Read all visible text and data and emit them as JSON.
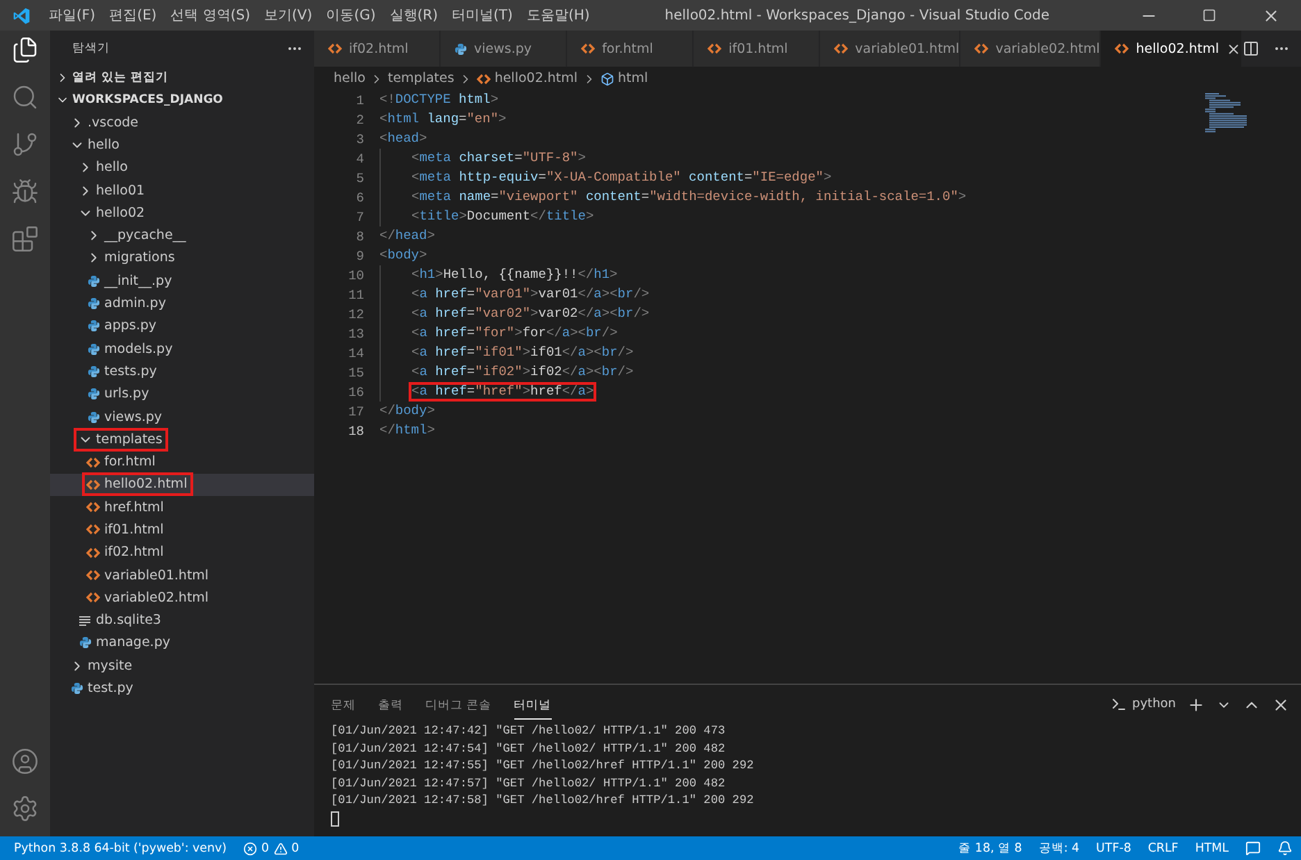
{
  "window": {
    "title": "hello02.html - Workspaces_Django - Visual Studio Code"
  },
  "menu": [
    "파일(F)",
    "편집(E)",
    "선택 영역(S)",
    "보기(V)",
    "이동(G)",
    "실행(R)",
    "터미널(T)",
    "도움말(H)"
  ],
  "sidebar": {
    "title": "탐색기",
    "sections": [
      {
        "label": "열려 있는 편집기",
        "expanded": false
      },
      {
        "label": "WORKSPACES_DJANGO",
        "expanded": true
      }
    ],
    "tree": [
      {
        "label": ".vscode",
        "kind": "folder",
        "expanded": false,
        "selected": false,
        "highlighted": false
      },
      {
        "label": "hello",
        "kind": "folder",
        "expanded": true,
        "selected": false,
        "highlighted": false,
        "children": [
          {
            "label": "hello",
            "kind": "folder",
            "expanded": false,
            "selected": false,
            "highlighted": false
          },
          {
            "label": "hello01",
            "kind": "folder",
            "expanded": false,
            "selected": false,
            "highlighted": false
          },
          {
            "label": "hello02",
            "kind": "folder",
            "expanded": true,
            "selected": false,
            "highlighted": false,
            "children": [
              {
                "label": "__pycache__",
                "kind": "folder",
                "expanded": false,
                "selected": false,
                "highlighted": false
              },
              {
                "label": "migrations",
                "kind": "folder",
                "expanded": false,
                "selected": false,
                "highlighted": false
              },
              {
                "label": "__init__.py",
                "kind": "py",
                "selected": false,
                "highlighted": false
              },
              {
                "label": "admin.py",
                "kind": "py",
                "selected": false,
                "highlighted": false
              },
              {
                "label": "apps.py",
                "kind": "py",
                "selected": false,
                "highlighted": false
              },
              {
                "label": "models.py",
                "kind": "py",
                "selected": false,
                "highlighted": false
              },
              {
                "label": "tests.py",
                "kind": "py",
                "selected": false,
                "highlighted": false
              },
              {
                "label": "urls.py",
                "kind": "py",
                "selected": false,
                "highlighted": false
              },
              {
                "label": "views.py",
                "kind": "py",
                "selected": false,
                "highlighted": false
              }
            ]
          },
          {
            "label": "templates",
            "kind": "folder",
            "expanded": true,
            "selected": false,
            "highlighted": true,
            "children": [
              {
                "label": "for.html",
                "kind": "html",
                "selected": false,
                "highlighted": false
              },
              {
                "label": "hello02.html",
                "kind": "html",
                "selected": true,
                "highlighted": true
              },
              {
                "label": "href.html",
                "kind": "html",
                "selected": false,
                "highlighted": false
              },
              {
                "label": "if01.html",
                "kind": "html",
                "selected": false,
                "highlighted": false
              },
              {
                "label": "if02.html",
                "kind": "html",
                "selected": false,
                "highlighted": false
              },
              {
                "label": "variable01.html",
                "kind": "html",
                "selected": false,
                "highlighted": false
              },
              {
                "label": "variable02.html",
                "kind": "html",
                "selected": false,
                "highlighted": false
              }
            ]
          },
          {
            "label": "db.sqlite3",
            "kind": "db",
            "selected": false,
            "highlighted": false
          },
          {
            "label": "manage.py",
            "kind": "py",
            "selected": false,
            "highlighted": false
          }
        ]
      },
      {
        "label": "mysite",
        "kind": "folder",
        "expanded": false,
        "selected": false,
        "highlighted": false
      },
      {
        "label": "test.py",
        "kind": "py",
        "selected": false,
        "highlighted": false
      }
    ]
  },
  "tabs": [
    {
      "label": "if02.html",
      "kind": "html",
      "selected": false
    },
    {
      "label": "views.py",
      "kind": "py",
      "selected": false
    },
    {
      "label": "for.html",
      "kind": "html",
      "selected": false
    },
    {
      "label": "if01.html",
      "kind": "html",
      "selected": false
    },
    {
      "label": "variable01.html",
      "kind": "html",
      "selected": false
    },
    {
      "label": "variable02.html",
      "kind": "html",
      "selected": false
    },
    {
      "label": "hello02.html",
      "kind": "html",
      "selected": true
    }
  ],
  "breadcrumbs": [
    {
      "label": "hello",
      "kind": "folder"
    },
    {
      "label": "templates",
      "kind": "folder"
    },
    {
      "label": "hello02.html",
      "kind": "html"
    },
    {
      "label": "html",
      "kind": "element"
    }
  ],
  "code": [
    {
      "number": "1",
      "indented": false,
      "highlighted": false,
      "current": false,
      "tokens": [
        {
          "text": "<!",
          "kind": "p"
        },
        {
          "text": "DOCTYPE",
          "kind": "g"
        },
        {
          "text": " html",
          "kind": "a"
        },
        {
          "text": ">",
          "kind": "p"
        }
      ]
    },
    {
      "number": "2",
      "indented": false,
      "highlighted": false,
      "current": false,
      "tokens": [
        {
          "text": "<",
          "kind": "p"
        },
        {
          "text": "html",
          "kind": "g"
        },
        {
          "text": " lang",
          "kind": "a"
        },
        {
          "text": "=",
          "kind": "t"
        },
        {
          "text": "\"en\"",
          "kind": "s"
        },
        {
          "text": ">",
          "kind": "p"
        }
      ]
    },
    {
      "number": "3",
      "indented": false,
      "highlighted": false,
      "current": false,
      "tokens": [
        {
          "text": "<",
          "kind": "p"
        },
        {
          "text": "head",
          "kind": "g"
        },
        {
          "text": ">",
          "kind": "p"
        }
      ]
    },
    {
      "number": "4",
      "indented": true,
      "highlighted": false,
      "current": false,
      "tokens": [
        {
          "text": "<",
          "kind": "p"
        },
        {
          "text": "meta",
          "kind": "g"
        },
        {
          "text": " charset",
          "kind": "a"
        },
        {
          "text": "=",
          "kind": "t"
        },
        {
          "text": "\"UTF-8\"",
          "kind": "s"
        },
        {
          "text": ">",
          "kind": "p"
        }
      ]
    },
    {
      "number": "5",
      "indented": true,
      "highlighted": false,
      "current": false,
      "tokens": [
        {
          "text": "<",
          "kind": "p"
        },
        {
          "text": "meta",
          "kind": "g"
        },
        {
          "text": " http-equiv",
          "kind": "a"
        },
        {
          "text": "=",
          "kind": "t"
        },
        {
          "text": "\"X-UA-Compatible\"",
          "kind": "s"
        },
        {
          "text": " content",
          "kind": "a"
        },
        {
          "text": "=",
          "kind": "t"
        },
        {
          "text": "\"IE=edge\"",
          "kind": "s"
        },
        {
          "text": ">",
          "kind": "p"
        }
      ]
    },
    {
      "number": "6",
      "indented": true,
      "highlighted": false,
      "current": false,
      "tokens": [
        {
          "text": "<",
          "kind": "p"
        },
        {
          "text": "meta",
          "kind": "g"
        },
        {
          "text": " name",
          "kind": "a"
        },
        {
          "text": "=",
          "kind": "t"
        },
        {
          "text": "\"viewport\"",
          "kind": "s"
        },
        {
          "text": " content",
          "kind": "a"
        },
        {
          "text": "=",
          "kind": "t"
        },
        {
          "text": "\"width=device-width, initial-scale=1.0\"",
          "kind": "s"
        },
        {
          "text": ">",
          "kind": "p"
        }
      ]
    },
    {
      "number": "7",
      "indented": true,
      "highlighted": false,
      "current": false,
      "tokens": [
        {
          "text": "<",
          "kind": "p"
        },
        {
          "text": "title",
          "kind": "g"
        },
        {
          "text": ">",
          "kind": "p"
        },
        {
          "text": "Document",
          "kind": "t"
        },
        {
          "text": "</",
          "kind": "p"
        },
        {
          "text": "title",
          "kind": "g"
        },
        {
          "text": ">",
          "kind": "p"
        }
      ]
    },
    {
      "number": "8",
      "indented": false,
      "highlighted": false,
      "current": false,
      "tokens": [
        {
          "text": "</",
          "kind": "p"
        },
        {
          "text": "head",
          "kind": "g"
        },
        {
          "text": ">",
          "kind": "p"
        }
      ]
    },
    {
      "number": "9",
      "indented": false,
      "highlighted": false,
      "current": false,
      "tokens": [
        {
          "text": "<",
          "kind": "p"
        },
        {
          "text": "body",
          "kind": "g"
        },
        {
          "text": ">",
          "kind": "p"
        }
      ]
    },
    {
      "number": "10",
      "indented": true,
      "highlighted": false,
      "current": false,
      "tokens": [
        {
          "text": "<",
          "kind": "p"
        },
        {
          "text": "h1",
          "kind": "g"
        },
        {
          "text": ">",
          "kind": "p"
        },
        {
          "text": "Hello, {{name}}!!",
          "kind": "t"
        },
        {
          "text": "</",
          "kind": "p"
        },
        {
          "text": "h1",
          "kind": "g"
        },
        {
          "text": ">",
          "kind": "p"
        }
      ]
    },
    {
      "number": "11",
      "indented": true,
      "highlighted": false,
      "current": false,
      "tokens": [
        {
          "text": "<",
          "kind": "p"
        },
        {
          "text": "a",
          "kind": "g"
        },
        {
          "text": " href",
          "kind": "a"
        },
        {
          "text": "=",
          "kind": "t"
        },
        {
          "text": "\"var01\"",
          "kind": "s"
        },
        {
          "text": ">",
          "kind": "p"
        },
        {
          "text": "var01",
          "kind": "t"
        },
        {
          "text": "</",
          "kind": "p"
        },
        {
          "text": "a",
          "kind": "g"
        },
        {
          "text": "><",
          "kind": "p"
        },
        {
          "text": "br",
          "kind": "g"
        },
        {
          "text": "/>",
          "kind": "p"
        }
      ]
    },
    {
      "number": "12",
      "indented": true,
      "highlighted": false,
      "current": false,
      "tokens": [
        {
          "text": "<",
          "kind": "p"
        },
        {
          "text": "a",
          "kind": "g"
        },
        {
          "text": " href",
          "kind": "a"
        },
        {
          "text": "=",
          "kind": "t"
        },
        {
          "text": "\"var02\"",
          "kind": "s"
        },
        {
          "text": ">",
          "kind": "p"
        },
        {
          "text": "var02",
          "kind": "t"
        },
        {
          "text": "</",
          "kind": "p"
        },
        {
          "text": "a",
          "kind": "g"
        },
        {
          "text": "><",
          "kind": "p"
        },
        {
          "text": "br",
          "kind": "g"
        },
        {
          "text": "/>",
          "kind": "p"
        }
      ]
    },
    {
      "number": "13",
      "indented": true,
      "highlighted": false,
      "current": false,
      "tokens": [
        {
          "text": "<",
          "kind": "p"
        },
        {
          "text": "a",
          "kind": "g"
        },
        {
          "text": " href",
          "kind": "a"
        },
        {
          "text": "=",
          "kind": "t"
        },
        {
          "text": "\"for\"",
          "kind": "s"
        },
        {
          "text": ">",
          "kind": "p"
        },
        {
          "text": "for",
          "kind": "t"
        },
        {
          "text": "</",
          "kind": "p"
        },
        {
          "text": "a",
          "kind": "g"
        },
        {
          "text": "><",
          "kind": "p"
        },
        {
          "text": "br",
          "kind": "g"
        },
        {
          "text": "/>",
          "kind": "p"
        }
      ]
    },
    {
      "number": "14",
      "indented": true,
      "highlighted": false,
      "current": false,
      "tokens": [
        {
          "text": "<",
          "kind": "p"
        },
        {
          "text": "a",
          "kind": "g"
        },
        {
          "text": " href",
          "kind": "a"
        },
        {
          "text": "=",
          "kind": "t"
        },
        {
          "text": "\"if01\"",
          "kind": "s"
        },
        {
          "text": ">",
          "kind": "p"
        },
        {
          "text": "if01",
          "kind": "t"
        },
        {
          "text": "</",
          "kind": "p"
        },
        {
          "text": "a",
          "kind": "g"
        },
        {
          "text": "><",
          "kind": "p"
        },
        {
          "text": "br",
          "kind": "g"
        },
        {
          "text": "/>",
          "kind": "p"
        }
      ]
    },
    {
      "number": "15",
      "indented": true,
      "highlighted": false,
      "current": false,
      "tokens": [
        {
          "text": "<",
          "kind": "p"
        },
        {
          "text": "a",
          "kind": "g"
        },
        {
          "text": " href",
          "kind": "a"
        },
        {
          "text": "=",
          "kind": "t"
        },
        {
          "text": "\"if02\"",
          "kind": "s"
        },
        {
          "text": ">",
          "kind": "p"
        },
        {
          "text": "if02",
          "kind": "t"
        },
        {
          "text": "</",
          "kind": "p"
        },
        {
          "text": "a",
          "kind": "g"
        },
        {
          "text": "><",
          "kind": "p"
        },
        {
          "text": "br",
          "kind": "g"
        },
        {
          "text": "/>",
          "kind": "p"
        }
      ]
    },
    {
      "number": "16",
      "indented": true,
      "highlighted": true,
      "current": false,
      "tokens": [
        {
          "text": "<",
          "kind": "p"
        },
        {
          "text": "a",
          "kind": "g"
        },
        {
          "text": " href",
          "kind": "a"
        },
        {
          "text": "=",
          "kind": "t"
        },
        {
          "text": "\"href\"",
          "kind": "s"
        },
        {
          "text": ">",
          "kind": "p"
        },
        {
          "text": "href",
          "kind": "t"
        },
        {
          "text": "</",
          "kind": "p"
        },
        {
          "text": "a",
          "kind": "g"
        },
        {
          "text": ">",
          "kind": "p"
        }
      ]
    },
    {
      "number": "17",
      "indented": false,
      "highlighted": false,
      "current": false,
      "tokens": [
        {
          "text": "</",
          "kind": "p"
        },
        {
          "text": "body",
          "kind": "g"
        },
        {
          "text": ">",
          "kind": "p"
        }
      ]
    },
    {
      "number": "18",
      "indented": false,
      "highlighted": false,
      "current": true,
      "tokens": [
        {
          "text": "</",
          "kind": "p"
        },
        {
          "text": "html",
          "kind": "g"
        },
        {
          "text": ">",
          "kind": "p"
        }
      ]
    }
  ],
  "panel": {
    "tabs": [
      {
        "label": "문제",
        "selected": false
      },
      {
        "label": "출력",
        "selected": false
      },
      {
        "label": "디버그 콘솔",
        "selected": false
      },
      {
        "label": "터미널",
        "selected": true
      }
    ],
    "terminal_name": "python",
    "lines": [
      "[01/Jun/2021 12:47:42] \"GET /hello02/ HTTP/1.1\" 200 473",
      "[01/Jun/2021 12:47:54] \"GET /hello02/ HTTP/1.1\" 200 482",
      "[01/Jun/2021 12:47:55] \"GET /hello02/href HTTP/1.1\" 200 292",
      "[01/Jun/2021 12:47:57] \"GET /hello02/ HTTP/1.1\" 200 482",
      "[01/Jun/2021 12:47:58] \"GET /hello02/href HTTP/1.1\" 200 292"
    ]
  },
  "status_bar": {
    "interpreter": "Python 3.8.8 64-bit ('pyweb': venv)",
    "errors": "0",
    "warnings": "0",
    "right": [
      "줄 18, 열 8",
      "공백: 4",
      "UTF-8",
      "CRLF",
      "HTML"
    ]
  }
}
